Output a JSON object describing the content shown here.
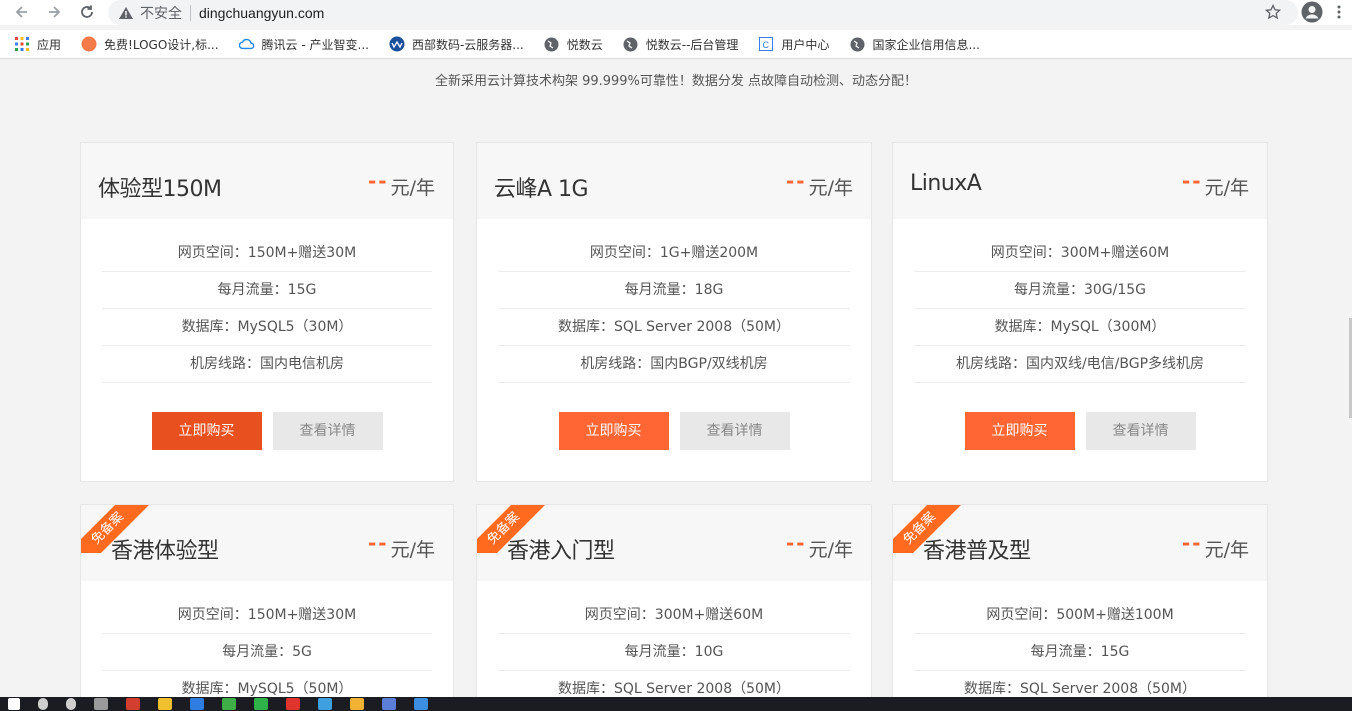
{
  "browser": {
    "security_label": "不安全",
    "url": "dingchuangyun.com",
    "bookmarks": [
      {
        "label": "应用",
        "icon": "apps-grid-icon"
      },
      {
        "label": "免费!LOGO设计,标...",
        "icon": "logo-site-icon"
      },
      {
        "label": "腾讯云 - 产业智变...",
        "icon": "tencent-cloud-icon"
      },
      {
        "label": "西部数码-云服务器...",
        "icon": "west-digital-icon"
      },
      {
        "label": "悦数云",
        "icon": "globe-icon"
      },
      {
        "label": "悦数云--后台管理",
        "icon": "globe-icon"
      },
      {
        "label": "用户中心",
        "icon": "page-icon"
      },
      {
        "label": "国家企业信用信息...",
        "icon": "globe-icon"
      }
    ]
  },
  "page": {
    "subtitle": "全新采用云计算技术构架 99.999%可靠性！数据分发 点故障自动检测、动态分配！",
    "price_placeholder": "--",
    "price_unit": "元/年",
    "buy_label": "立即购买",
    "detail_label": "查看详情",
    "ribbon_label": "免备案",
    "accent_color": "#ff6633",
    "plans": [
      {
        "name": "体验型150M",
        "features": [
          "网页空间：150M+赠送30M",
          "每月流量：15G",
          "数据库：MySQL5（30M）",
          "机房线路：国内电信机房"
        ]
      },
      {
        "name": "云峰A 1G",
        "features": [
          "网页空间：1G+赠送200M",
          "每月流量：18G",
          "数据库：SQL Server 2008（50M）",
          "机房线路：国内BGP/双线机房"
        ]
      },
      {
        "name": "LinuxA",
        "features": [
          "网页空间：300M+赠送60M",
          "每月流量：30G/15G",
          "数据库：MySQL（300M）",
          "机房线路：国内双线/电信/BGP多线机房"
        ]
      },
      {
        "name": "香港体验型",
        "features": [
          "网页空间：150M+赠送30M",
          "每月流量：5G",
          "数据库：MySQL5（50M）"
        ]
      },
      {
        "name": "香港入门型",
        "features": [
          "网页空间：300M+赠送60M",
          "每月流量：10G",
          "数据库：SQL Server 2008（50M）"
        ]
      },
      {
        "name": "香港普及型",
        "features": [
          "网页空间：500M+赠送100M",
          "每月流量：15G",
          "数据库：SQL Server 2008（50M）"
        ]
      }
    ]
  }
}
